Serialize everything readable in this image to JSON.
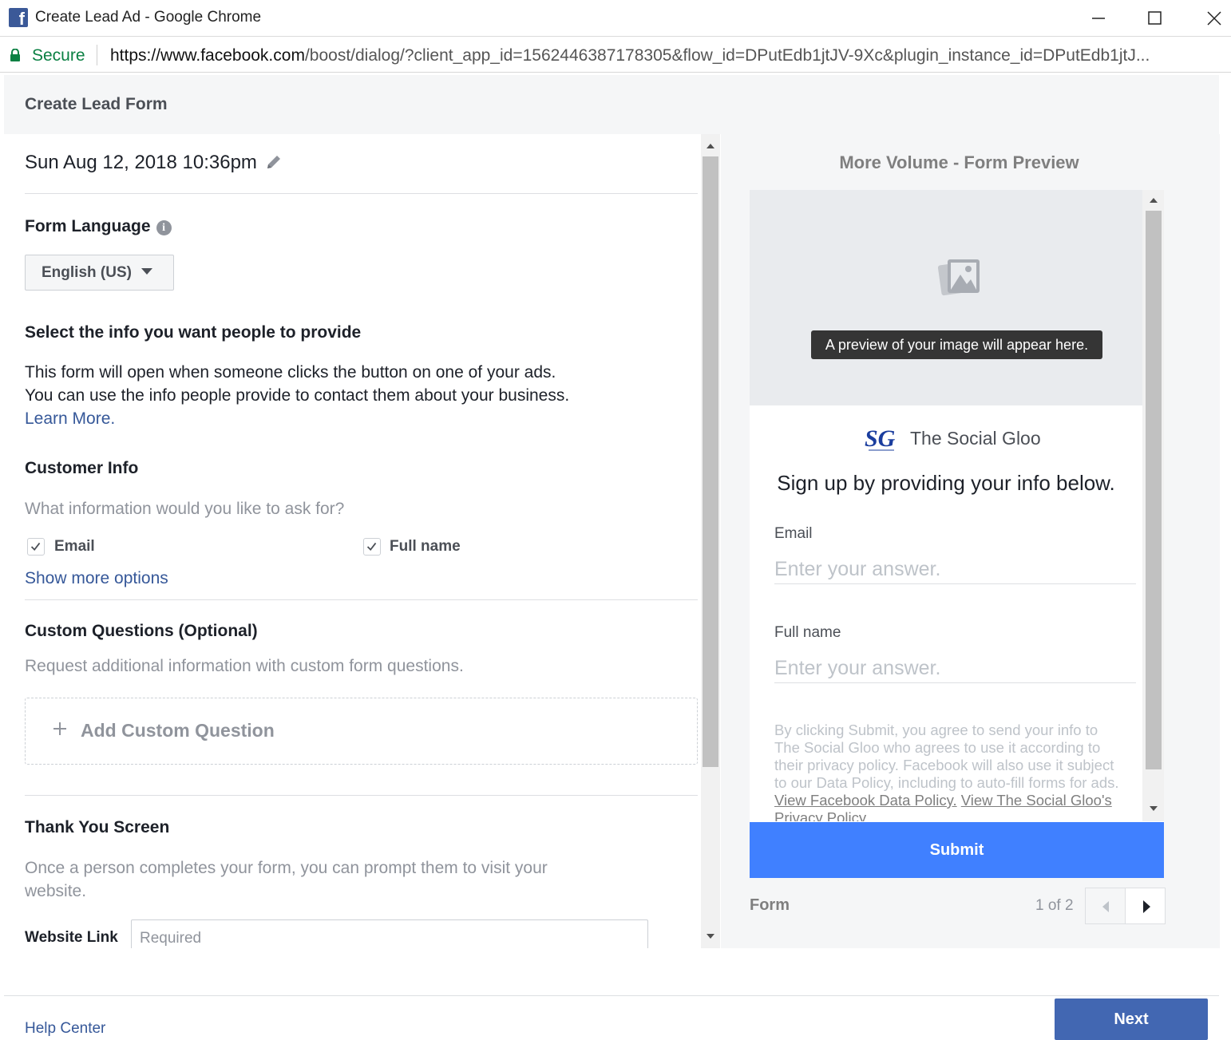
{
  "window": {
    "title": "Create Lead Ad - Google Chrome",
    "favicon_letter": "f"
  },
  "addressbar": {
    "secure_label": "Secure",
    "url_host": "https://www.facebook.com",
    "url_path": "/boost/dialog/?client_app_id=1562446387178305&flow_id=DPutEdb1jtJV-9Xc&plugin_instance_id=DPutEdb1jtJ..."
  },
  "dialog": {
    "title": "Create Lead Form"
  },
  "form": {
    "name": "Sun Aug 12, 2018 10:36pm",
    "language_heading": "Form Language",
    "language_selected": "English (US)",
    "select_info_heading": "Select the info you want people to provide",
    "select_info_line1": "This form will open when someone clicks the button on one of your ads.",
    "select_info_line2": "You can use the info people provide to contact them about your business.",
    "learn_more": "Learn More.",
    "customer_info_heading": "Customer Info",
    "customer_info_sub": "What information would you like to ask for?",
    "fields": [
      {
        "label": "Email",
        "checked": true
      },
      {
        "label": "Full name",
        "checked": true
      }
    ],
    "show_more": "Show more options",
    "custom_q_heading": "Custom Questions (Optional)",
    "custom_q_sub": "Request additional information with custom form questions.",
    "add_custom_q": "Add Custom Question",
    "thank_you_heading": "Thank You Screen",
    "thank_you_line1": "Once a person completes your form, you can prompt them to visit your",
    "thank_you_line2": "website.",
    "website_label": "Website Link",
    "website_placeholder": "Required"
  },
  "preview": {
    "title": "More Volume - Form Preview",
    "image_tip": "A preview of your image will appear here.",
    "brand_name": "The Social Gloo",
    "logo_text": "SG",
    "signup_text": "Sign up by providing your info below.",
    "email_label": "Email",
    "email_placeholder": "Enter your answer.",
    "fullname_label": "Full name",
    "fullname_placeholder": "Enter your answer.",
    "disclaimer_text": "By clicking Submit, you agree to send your info to The Social Gloo who agrees to use it according to their privacy policy. Facebook will also use it subject to our Data Policy, including to auto-fill forms for ads. ",
    "disclaimer_link1": "View Facebook Data Policy.",
    "disclaimer_link2": "View The Social Gloo's Privacy Policy",
    "submit_label": "Submit",
    "pager_label": "Form",
    "pager_count": "1 of 2"
  },
  "footer": {
    "help_link": "Help Center",
    "next_label": "Next"
  },
  "colors": {
    "facebook_blue": "#4267b2",
    "submit_blue": "#4080ff",
    "link": "#365899",
    "secure_green": "#0b8043"
  }
}
